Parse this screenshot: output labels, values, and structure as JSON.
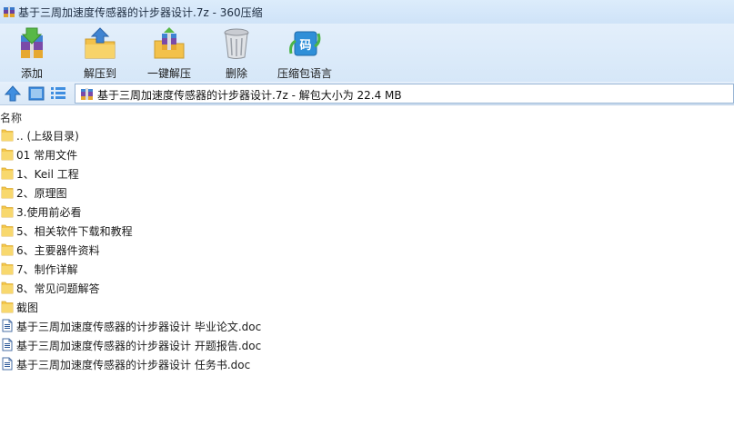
{
  "window": {
    "title": "基于三周加速度传感器的计步器设计.7z - 360压缩"
  },
  "toolbar": {
    "buttons": [
      {
        "label": "添加",
        "icon": "add-archive-icon"
      },
      {
        "label": "解压到",
        "icon": "extract-to-folder-icon"
      },
      {
        "label": "一键解压",
        "icon": "one-click-extract-icon"
      },
      {
        "label": "删除",
        "icon": "trash-can-icon"
      },
      {
        "label": "压缩包语言",
        "icon": "archive-language-icon"
      }
    ],
    "language_glyph": "码"
  },
  "addressbar": {
    "path": "基于三周加速度传感器的计步器设计.7z - 解包大小为 22.4 MB"
  },
  "filelist": {
    "column_name": "名称",
    "items": [
      {
        "name": ".. (上级目录)",
        "type": "folder"
      },
      {
        "name": "01 常用文件",
        "type": "folder"
      },
      {
        "name": "1、Keil 工程",
        "type": "folder"
      },
      {
        "name": "2、原理图",
        "type": "folder"
      },
      {
        "name": "3.使用前必看",
        "type": "folder"
      },
      {
        "name": "5、相关软件下载和教程",
        "type": "folder"
      },
      {
        "name": "6、主要器件资料",
        "type": "folder"
      },
      {
        "name": "7、制作详解",
        "type": "folder"
      },
      {
        "name": "8、常见问题解答",
        "type": "folder"
      },
      {
        "name": "截图",
        "type": "folder"
      },
      {
        "name": "基于三周加速度传感器的计步器设计 毕业论文.doc",
        "type": "doc"
      },
      {
        "name": "基于三周加速度传感器的计步器设计 开题报告.doc",
        "type": "doc"
      },
      {
        "name": "基于三周加速度传感器的计步器设计 任务书.doc",
        "type": "doc"
      }
    ]
  },
  "colors": {
    "accent": "#2b6cc4",
    "folder": "#f5c84c"
  }
}
